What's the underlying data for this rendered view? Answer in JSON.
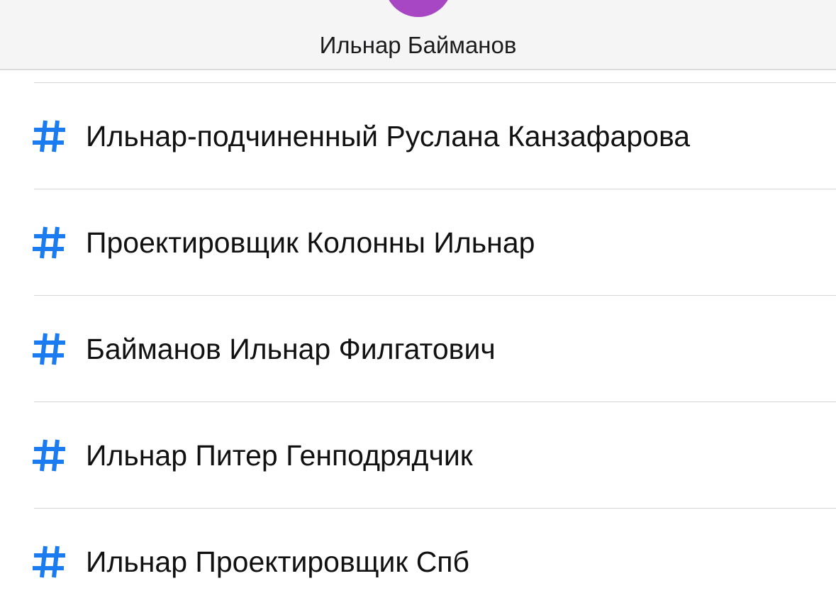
{
  "colors": {
    "avatar": "#a847c4",
    "hash_icon": "#1a7cf0"
  },
  "header": {
    "name": "Ильнар Байманов"
  },
  "channels": [
    {
      "icon": "hash-icon",
      "label": "Ильнар-подчиненный Руслана Канзафарова"
    },
    {
      "icon": "hash-icon",
      "label": "Проектировщик Колонны Ильнар"
    },
    {
      "icon": "hash-icon",
      "label": "Байманов Ильнар Филгатович"
    },
    {
      "icon": "hash-icon",
      "label": "Ильнар Питер Генподрядчик"
    },
    {
      "icon": "hash-icon",
      "label": "Ильнар Проектировщик Спб"
    }
  ]
}
